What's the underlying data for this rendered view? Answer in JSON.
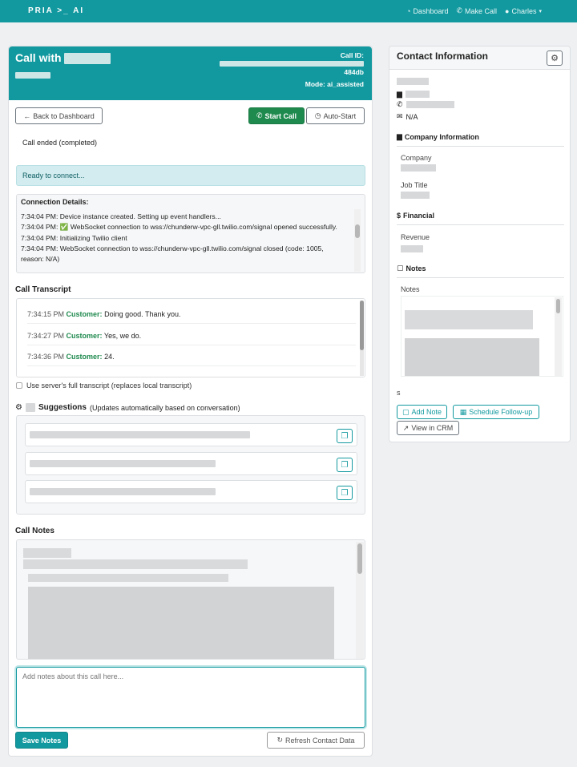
{
  "nav": {
    "brand": "PRIA >_ AI",
    "dashboard": "Dashboard",
    "make_call": "Make Call",
    "user": "Charles"
  },
  "call": {
    "title": "Call with",
    "call_id_label": "Call ID:",
    "call_id_suffix": "484db",
    "mode": "Mode: ai_assisted",
    "back_button": "Back to Dashboard",
    "start_button": "Start Call",
    "auto_start_button": "Auto-Start",
    "status": "Call ended (completed)",
    "ready_message": "Ready to connect...",
    "connection_title": "Connection Details:",
    "connection_log": [
      "7:34:04 PM: Device instance created. Setting up event handlers...",
      "7:34:04 PM: ✅ WebSocket connection to wss://chunderw-vpc-gll.twilio.com/signal opened successfully.",
      "7:34:04 PM: Initializing Twilio client",
      "7:34:04 PM: WebSocket connection to wss://chunderw-vpc-gll.twilio.com/signal closed (code: 1005, reason: N/A)"
    ],
    "transcript_title": "Call Transcript",
    "transcript": [
      {
        "time": "7:34:15 PM",
        "speaker": "Customer:",
        "text": "Doing good. Thank you."
      },
      {
        "time": "7:34:27 PM",
        "speaker": "Customer:",
        "text": "Yes, we do."
      },
      {
        "time": "7:34:36 PM",
        "speaker": "Customer:",
        "text": "24."
      }
    ],
    "server_transcript_label": "Use server's full transcript (replaces local transcript)",
    "suggestions_title": "Suggestions",
    "suggestions_note": "(Updates automatically based on conversation)",
    "notes_title": "Call Notes",
    "notes_placeholder": "Add notes about this call here...",
    "save_notes_button": "Save Notes",
    "refresh_button": "Refresh Contact Data"
  },
  "contact": {
    "title": "Contact Information",
    "email": "N/A",
    "company_section": "Company Information",
    "company_label": "Company",
    "job_title_label": "Job Title",
    "financial_section": "Financial",
    "revenue_label": "Revenue",
    "notes_section": "Notes",
    "notes_label": "Notes",
    "trailing_text": "s",
    "add_note_button": "Add Note",
    "schedule_button": "Schedule Follow-up",
    "crm_button": "View in CRM"
  },
  "colors": {
    "brand": "#12999f",
    "success": "#1f8a4e",
    "alert_bg": "#d2ecef"
  },
  "icons": [
    "dashboard-icon",
    "phone-icon",
    "user-icon",
    "caret-down-icon",
    "arrow-left-icon",
    "clock-icon",
    "copy-icon",
    "robot-icon",
    "gear-icon",
    "building-icon",
    "envelope-icon",
    "dollar-icon",
    "note-icon",
    "calendar-icon",
    "external-link-icon",
    "refresh-icon"
  ]
}
